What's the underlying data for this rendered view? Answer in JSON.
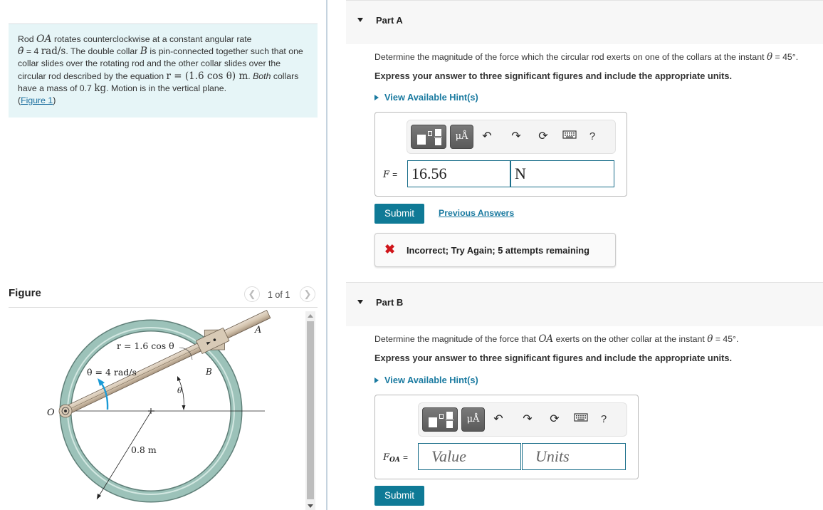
{
  "problem": {
    "text_1": "Rod ",
    "rod_name": "OA",
    "text_2": " rotates counterclockwise at a constant angular rate",
    "thetadot_symbol": "θ̇",
    "text_3": " = 4 ",
    "rate_units": "rad/s",
    "text_4": ". The double collar ",
    "collar_name": "B",
    "text_5": " is pin-connected together such that one collar slides over the rotating rod and the other collar slides over the circular rod described by the equation ",
    "equation": "r = (1.6 cos θ) m",
    "text_6": ". ",
    "text_7": "Both",
    "text_8": " collars have a mass of 0.7 ",
    "mass_units": "kg",
    "text_9": ". Motion is in the vertical plane.",
    "figure_link_open": "(",
    "figure_link": "Figure 1",
    "figure_link_close": ")"
  },
  "figure": {
    "title": "Figure",
    "counter": "1 of 1",
    "prev_icon": "chevron-left-icon",
    "next_icon": "chevron-right-icon",
    "labels": {
      "equation": "r = 1.6 cos θ",
      "angular_rate": "θ̇ = 4 rad/s",
      "point_a": "A",
      "point_b": "B",
      "point_o": "O",
      "angle": "θ",
      "radius": "0.8 m"
    },
    "colors": {
      "ring": "#8fb5ad",
      "rod": "#d6c8b4",
      "arrow": "#1a9ad6"
    }
  },
  "parts": [
    {
      "title": "Part A",
      "question_1": "Determine the magnitude of the force which the circular rod exerts on one of the collars at the instant ",
      "question_theta": "θ",
      "question_2": " = 45°.",
      "instructions": "Express your answer to three significant figures and include the appropriate units.",
      "hint_label": "View Available Hint(s)",
      "toolbar": [
        "templates-icon",
        "units-icon",
        "undo-icon",
        "redo-icon",
        "reset-icon",
        "keyboard-icon",
        "help-icon"
      ],
      "units_button": "μÅ",
      "help_label": "?",
      "variable": "F",
      "variable_sub": "",
      "equals": "=",
      "value": "16.56",
      "units": "N",
      "submit_label": "Submit",
      "previous_answers_label": "Previous Answers",
      "feedback": {
        "status": "incorrect",
        "icon": "x-icon",
        "message": "Incorrect; Try Again; 5 attempts remaining",
        "color": "#d0161b"
      }
    },
    {
      "title": "Part B",
      "question_1": "Determine the magnitude of the force that ",
      "question_rod": "OA",
      "question_1b": " exerts on the other collar at the instant ",
      "question_theta": "θ",
      "question_2": " = 45°.",
      "instructions": "Express your answer to three significant figures and include the appropriate units.",
      "hint_label": "View Available Hint(s)",
      "units_button": "μÅ",
      "help_label": "?",
      "variable": "F",
      "variable_sub": "OA",
      "equals": "=",
      "value_placeholder": "Value",
      "units_placeholder": "Units",
      "submit_label": "Submit"
    }
  ],
  "colors": {
    "accent": "#0f7a96",
    "link": "#1a7aa0",
    "problem_bg": "#e6f5f7"
  }
}
